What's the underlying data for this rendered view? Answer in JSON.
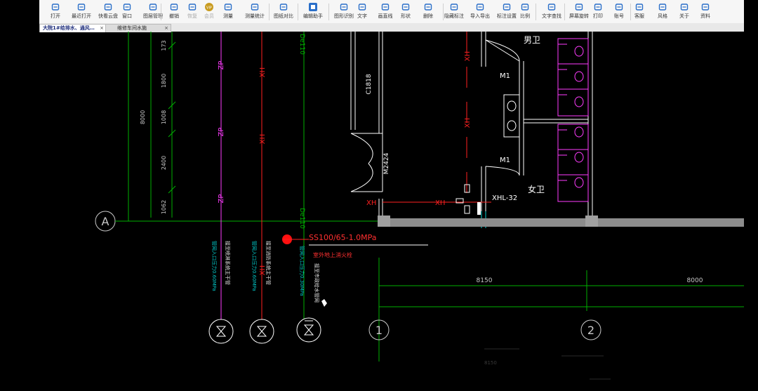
{
  "toolbar": {
    "buttons": [
      {
        "label": "打开",
        "icon": "folder-icon"
      },
      {
        "label": "最近打开",
        "icon": "clock-icon"
      },
      {
        "label": "快看云盘",
        "icon": "cloud-icon"
      },
      {
        "label": "窗口",
        "icon": "window-icon"
      },
      {
        "label": "图层管理",
        "icon": "layers-icon"
      },
      {
        "label": "撤销",
        "icon": "undo-icon"
      },
      {
        "label": "恢复",
        "icon": "redo-icon"
      },
      {
        "label": "会员",
        "icon": "vip-icon"
      },
      {
        "label": "测量",
        "icon": "measure-icon"
      },
      {
        "label": "测量统计",
        "icon": "measure-stats-icon"
      },
      {
        "label": "图纸对比",
        "icon": "compare-icon"
      },
      {
        "label": "编辑助手",
        "icon": "edit-assistant-icon"
      },
      {
        "label": "图形识别",
        "icon": "shape-recognize-icon"
      },
      {
        "label": "文字",
        "icon": "text-icon"
      },
      {
        "label": "画直线",
        "icon": "line-icon"
      },
      {
        "label": "形状",
        "icon": "shape-icon"
      },
      {
        "label": "删除",
        "icon": "eraser-icon"
      },
      {
        "label": "隐藏标注",
        "icon": "hide-annotation-icon"
      },
      {
        "label": "导入导出",
        "icon": "import-export-icon"
      },
      {
        "label": "标注设置",
        "icon": "annotation-settings-icon"
      },
      {
        "label": "比例",
        "icon": "scale-icon"
      },
      {
        "label": "文字查找",
        "icon": "text-search-icon"
      },
      {
        "label": "屏幕旋转",
        "icon": "rotate-screen-icon"
      },
      {
        "label": "打印",
        "icon": "print-icon"
      },
      {
        "label": "账号",
        "icon": "user-icon"
      },
      {
        "label": "客服",
        "icon": "headset-icon"
      },
      {
        "label": "风格",
        "icon": "style-icon"
      },
      {
        "label": "关于",
        "icon": "info-icon"
      },
      {
        "label": "资料",
        "icon": "document-icon"
      }
    ]
  },
  "tabs": [
    {
      "label": "大院1#给排水、通风…",
      "close": "×",
      "active": true
    },
    {
      "label": "维修车间水施",
      "close": "×",
      "active": false
    }
  ],
  "drawing": {
    "axis_A": "A",
    "axis_1": "1",
    "axis_2": "2",
    "dims_left": [
      "173",
      "1800",
      "1008",
      "8000",
      "2400",
      "1062"
    ],
    "pipe_ZP": "ZP",
    "pipe_XH": "XH",
    "pipe_De": "De110",
    "room_male": "男卫",
    "room_female": "女卫",
    "door_m1": "M1",
    "door_m2": "M1",
    "door_m2424": "M2424",
    "window_c1818": "C1818",
    "hydrant_label": "XHL-32",
    "valve_spec": "SS100/65-1.0MPa",
    "valve_note": "室外地上消火栓",
    "pipe_note_1": "接至喷淋系统主干管",
    "pipe_note_1b": "管网入口压力0.60MPa",
    "pipe_note_2": "接至消防系统主干管",
    "pipe_note_2b": "管网入口压力0.60MPa",
    "pipe_note_3": "接至市政给水管网",
    "pipe_note_3b": "管网入口压力0.30MPa",
    "dim_8150": "8150",
    "dim_8000": "8000",
    "dim_bottom": "8150"
  },
  "colors": {
    "axis": "#00b000",
    "wall": "#ffffff",
    "pipe_zp": "#ff3cff",
    "pipe_xh": "#ff2020",
    "pipe_cyan": "#00d0d0",
    "dim": "#c8c8c8"
  }
}
